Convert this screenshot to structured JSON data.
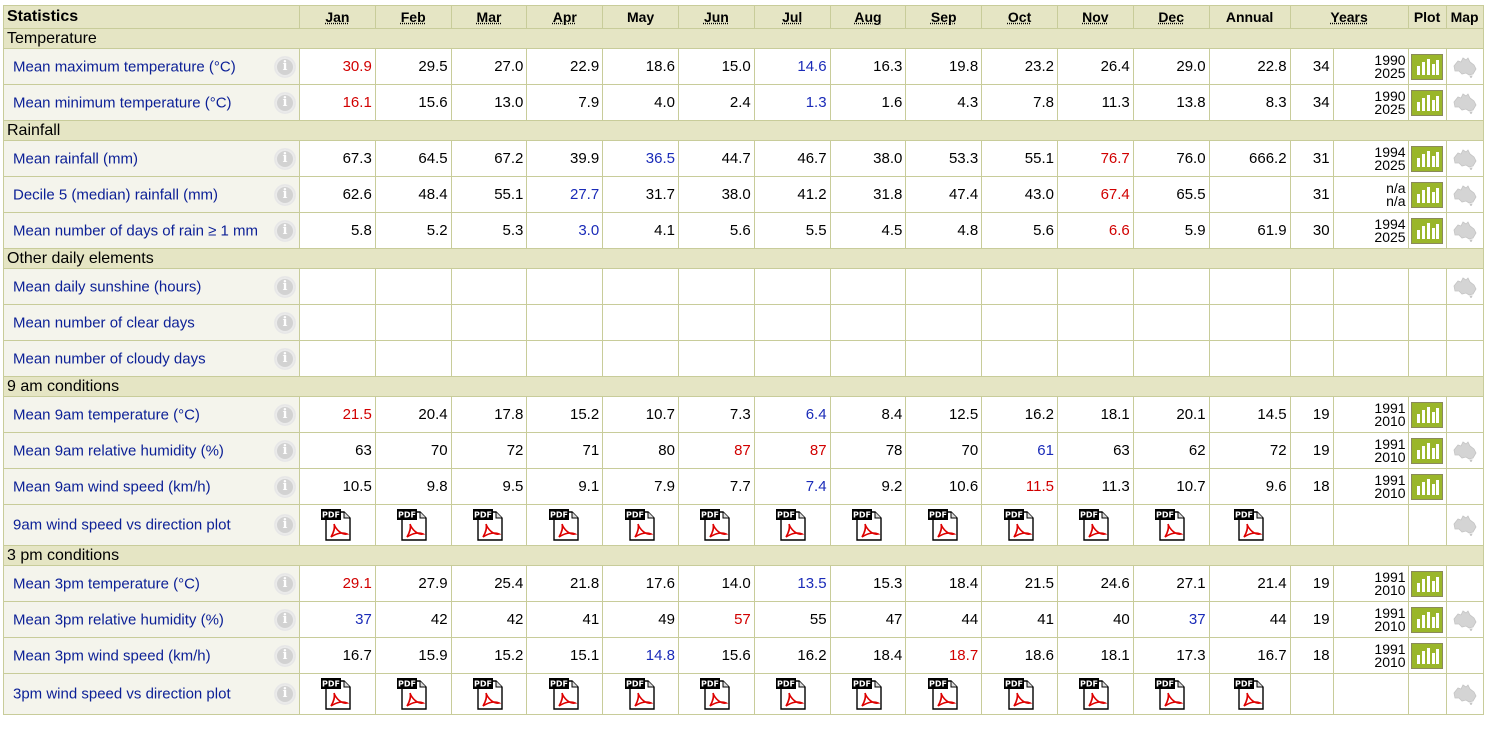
{
  "header": {
    "statistics": "Statistics",
    "months": [
      "Jan",
      "Feb",
      "Mar",
      "Apr",
      "May",
      "Jun",
      "Jul",
      "Aug",
      "Sep",
      "Oct",
      "Nov",
      "Dec"
    ],
    "annual": "Annual",
    "years": "Years",
    "plot": "Plot",
    "map": "Map"
  },
  "sections": [
    {
      "title": "Temperature",
      "rows": [
        {
          "label": "Mean maximum temperature (°C)",
          "values": [
            "30.9",
            "29.5",
            "27.0",
            "22.9",
            "18.6",
            "15.0",
            "14.6",
            "16.3",
            "19.8",
            "23.2",
            "26.4",
            "29.0"
          ],
          "hi": 0,
          "lo": 6,
          "annual": "22.8",
          "years": "34",
          "range": [
            "1990",
            "2025"
          ],
          "plot": true,
          "map": true
        },
        {
          "label": "Mean minimum temperature (°C)",
          "values": [
            "16.1",
            "15.6",
            "13.0",
            "7.9",
            "4.0",
            "2.4",
            "1.3",
            "1.6",
            "4.3",
            "7.8",
            "11.3",
            "13.8"
          ],
          "hi": 0,
          "lo": 6,
          "annual": "8.3",
          "years": "34",
          "range": [
            "1990",
            "2025"
          ],
          "plot": true,
          "map": true
        }
      ]
    },
    {
      "title": "Rainfall",
      "rows": [
        {
          "label": "Mean rainfall (mm)",
          "values": [
            "67.3",
            "64.5",
            "67.2",
            "39.9",
            "36.5",
            "44.7",
            "46.7",
            "38.0",
            "53.3",
            "55.1",
            "76.7",
            "76.0"
          ],
          "hi": 10,
          "lo": 4,
          "annual": "666.2",
          "years": "31",
          "range": [
            "1994",
            "2025"
          ],
          "plot": true,
          "map": true
        },
        {
          "label": "Decile 5 (median) rainfall (mm)",
          "values": [
            "62.6",
            "48.4",
            "55.1",
            "27.7",
            "31.7",
            "38.0",
            "41.2",
            "31.8",
            "47.4",
            "43.0",
            "67.4",
            "65.5"
          ],
          "hi": 10,
          "lo": 3,
          "annual": "",
          "years": "31",
          "range": [
            "n/a",
            "n/a"
          ],
          "plot": true,
          "map": true
        },
        {
          "label": "Mean number of days of rain ≥ 1 mm",
          "values": [
            "5.8",
            "5.2",
            "5.3",
            "3.0",
            "4.1",
            "5.6",
            "5.5",
            "4.5",
            "4.8",
            "5.6",
            "6.6",
            "5.9"
          ],
          "hi": 10,
          "lo": 3,
          "annual": "61.9",
          "years": "30",
          "range": [
            "1994",
            "2025"
          ],
          "plot": true,
          "map": true
        }
      ]
    },
    {
      "title": "Other daily elements",
      "rows": [
        {
          "label": "Mean daily sunshine (hours)",
          "values": [
            "",
            "",
            "",
            "",
            "",
            "",
            "",
            "",
            "",
            "",
            "",
            ""
          ],
          "hi": -1,
          "lo": -1,
          "annual": "",
          "years": "",
          "range": [
            "",
            ""
          ],
          "plot": false,
          "map": true
        },
        {
          "label": "Mean number of clear days",
          "values": [
            "",
            "",
            "",
            "",
            "",
            "",
            "",
            "",
            "",
            "",
            "",
            ""
          ],
          "hi": -1,
          "lo": -1,
          "annual": "",
          "years": "",
          "range": [
            "",
            ""
          ],
          "plot": false,
          "map": false
        },
        {
          "label": "Mean number of cloudy days",
          "values": [
            "",
            "",
            "",
            "",
            "",
            "",
            "",
            "",
            "",
            "",
            "",
            ""
          ],
          "hi": -1,
          "lo": -1,
          "annual": "",
          "years": "",
          "range": [
            "",
            ""
          ],
          "plot": false,
          "map": false
        }
      ]
    },
    {
      "title": "9 am conditions",
      "rows": [
        {
          "label": "Mean 9am temperature (°C)",
          "values": [
            "21.5",
            "20.4",
            "17.8",
            "15.2",
            "10.7",
            "7.3",
            "6.4",
            "8.4",
            "12.5",
            "16.2",
            "18.1",
            "20.1"
          ],
          "hi": 0,
          "lo": 6,
          "annual": "14.5",
          "years": "19",
          "range": [
            "1991",
            "2010"
          ],
          "plot": true,
          "map": false
        },
        {
          "label": "Mean 9am relative humidity (%)",
          "values": [
            "63",
            "70",
            "72",
            "71",
            "80",
            "87",
            "87",
            "78",
            "70",
            "61",
            "63",
            "62"
          ],
          "hi": [
            5,
            6
          ],
          "lo": 9,
          "annual": "72",
          "years": "19",
          "range": [
            "1991",
            "2010"
          ],
          "plot": true,
          "map": true
        },
        {
          "label": "Mean 9am wind speed (km/h)",
          "values": [
            "10.5",
            "9.8",
            "9.5",
            "9.1",
            "7.9",
            "7.7",
            "7.4",
            "9.2",
            "10.6",
            "11.5",
            "11.3",
            "10.7"
          ],
          "hi": 9,
          "lo": 6,
          "annual": "9.6",
          "years": "18",
          "range": [
            "1991",
            "2010"
          ],
          "plot": true,
          "map": false
        },
        {
          "label": "9am wind speed vs direction plot",
          "pdf": true,
          "map": true
        }
      ]
    },
    {
      "title": "3 pm conditions",
      "rows": [
        {
          "label": "Mean 3pm temperature (°C)",
          "values": [
            "29.1",
            "27.9",
            "25.4",
            "21.8",
            "17.6",
            "14.0",
            "13.5",
            "15.3",
            "18.4",
            "21.5",
            "24.6",
            "27.1"
          ],
          "hi": 0,
          "lo": 6,
          "annual": "21.4",
          "years": "19",
          "range": [
            "1991",
            "2010"
          ],
          "plot": true,
          "map": false
        },
        {
          "label": "Mean 3pm relative humidity (%)",
          "values": [
            "37",
            "42",
            "42",
            "41",
            "49",
            "57",
            "55",
            "47",
            "44",
            "41",
            "40",
            "37"
          ],
          "hi": 5,
          "lo": [
            0,
            11
          ],
          "annual": "44",
          "years": "19",
          "range": [
            "1991",
            "2010"
          ],
          "plot": true,
          "map": true
        },
        {
          "label": "Mean 3pm wind speed (km/h)",
          "values": [
            "16.7",
            "15.9",
            "15.2",
            "15.1",
            "14.8",
            "15.6",
            "16.2",
            "18.4",
            "18.7",
            "18.6",
            "18.1",
            "17.3"
          ],
          "hi": 8,
          "lo": 4,
          "annual": "16.7",
          "years": "18",
          "range": [
            "1991",
            "2010"
          ],
          "plot": true,
          "map": false
        },
        {
          "label": "3pm wind speed vs direction plot",
          "pdf": true,
          "map": true
        }
      ]
    }
  ],
  "icons": {
    "info": "info-icon",
    "plot": "bar-chart-icon",
    "map": "australia-map-icon",
    "pdf": "pdf-icon"
  },
  "colors": {
    "high": "#d10000",
    "low": "#1a2bb8",
    "label": "#0b1f96",
    "header_bg": "#e5e5c4",
    "border": "#c8cc9a"
  }
}
